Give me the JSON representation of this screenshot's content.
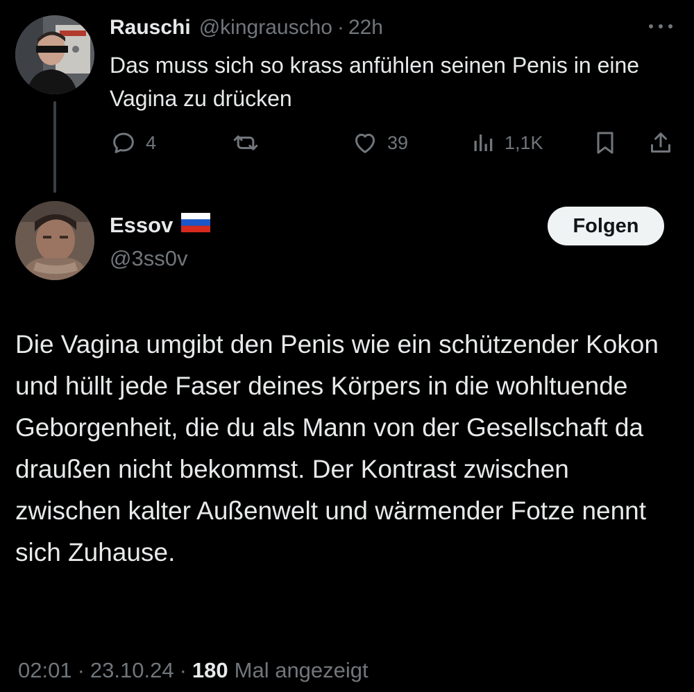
{
  "parent_tweet": {
    "display_name": "Rauschi",
    "handle": "@kingrauscho",
    "separator": "·",
    "age": "22h",
    "text": "Das muss sich so krass anfühlen seinen Penis in eine Vagina zu drücken",
    "actions": {
      "reply_icon": "reply-icon",
      "reply_count": "4",
      "retweet_icon": "retweet-icon",
      "like_icon": "heart-icon",
      "like_count": "39",
      "views_icon": "views-bar-chart-icon",
      "views_count": "1,1K",
      "bookmark_icon": "bookmark-icon",
      "share_icon": "share-icon"
    },
    "more_icon": "more-horizontal-icon"
  },
  "reply_tweet": {
    "display_name": "Essov",
    "flag_icon": "russian-flag-icon",
    "handle": "@3ss0v",
    "follow_label": "Folgen",
    "text": "Die Vagina umgibt den Penis wie ein schützender Kokon und hüllt jede Faser deines Körpers in die wohltuende Geborgenheit, die du als Mann von der Gesellschaft da draußen nicht bekommst. Der Kontrast zwischen zwischen kalter Außenwelt und wärmender Fotze nennt sich Zuhause.",
    "time": "02:01",
    "separator": "·",
    "date": "23.10.24",
    "views_count": "180",
    "views_label": "Mal angezeigt"
  },
  "colors": {
    "background": "#000000",
    "primary_text": "#e7e9ea",
    "secondary_text": "#71767b",
    "thread_line": "#3b3f44",
    "follow_button_bg": "#eff3f4",
    "follow_button_text": "#0f1419"
  }
}
